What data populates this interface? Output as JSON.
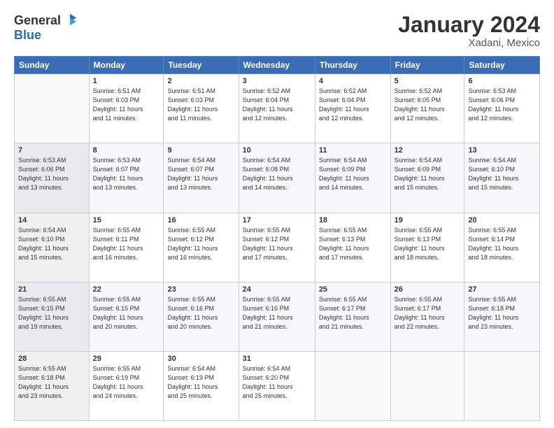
{
  "logo": {
    "general": "General",
    "blue": "Blue"
  },
  "title": "January 2024",
  "location": "Xadani, Mexico",
  "header_days": [
    "Sunday",
    "Monday",
    "Tuesday",
    "Wednesday",
    "Thursday",
    "Friday",
    "Saturday"
  ],
  "weeks": [
    [
      {
        "day": "",
        "info": ""
      },
      {
        "day": "1",
        "info": "Sunrise: 6:51 AM\nSunset: 6:03 PM\nDaylight: 11 hours\nand 11 minutes."
      },
      {
        "day": "2",
        "info": "Sunrise: 6:51 AM\nSunset: 6:03 PM\nDaylight: 11 hours\nand 11 minutes."
      },
      {
        "day": "3",
        "info": "Sunrise: 6:52 AM\nSunset: 6:04 PM\nDaylight: 11 hours\nand 12 minutes."
      },
      {
        "day": "4",
        "info": "Sunrise: 6:52 AM\nSunset: 6:04 PM\nDaylight: 11 hours\nand 12 minutes."
      },
      {
        "day": "5",
        "info": "Sunrise: 6:52 AM\nSunset: 6:05 PM\nDaylight: 11 hours\nand 12 minutes."
      },
      {
        "day": "6",
        "info": "Sunrise: 6:53 AM\nSunset: 6:06 PM\nDaylight: 11 hours\nand 12 minutes."
      }
    ],
    [
      {
        "day": "7",
        "info": "Sunrise: 6:53 AM\nSunset: 6:06 PM\nDaylight: 11 hours\nand 13 minutes."
      },
      {
        "day": "8",
        "info": "Sunrise: 6:53 AM\nSunset: 6:07 PM\nDaylight: 11 hours\nand 13 minutes."
      },
      {
        "day": "9",
        "info": "Sunrise: 6:54 AM\nSunset: 6:07 PM\nDaylight: 11 hours\nand 13 minutes."
      },
      {
        "day": "10",
        "info": "Sunrise: 6:54 AM\nSunset: 6:08 PM\nDaylight: 11 hours\nand 14 minutes."
      },
      {
        "day": "11",
        "info": "Sunrise: 6:54 AM\nSunset: 6:09 PM\nDaylight: 11 hours\nand 14 minutes."
      },
      {
        "day": "12",
        "info": "Sunrise: 6:54 AM\nSunset: 6:09 PM\nDaylight: 11 hours\nand 15 minutes."
      },
      {
        "day": "13",
        "info": "Sunrise: 6:54 AM\nSunset: 6:10 PM\nDaylight: 11 hours\nand 15 minutes."
      }
    ],
    [
      {
        "day": "14",
        "info": "Sunrise: 6:54 AM\nSunset: 6:10 PM\nDaylight: 11 hours\nand 15 minutes."
      },
      {
        "day": "15",
        "info": "Sunrise: 6:55 AM\nSunset: 6:11 PM\nDaylight: 11 hours\nand 16 minutes."
      },
      {
        "day": "16",
        "info": "Sunrise: 6:55 AM\nSunset: 6:12 PM\nDaylight: 11 hours\nand 16 minutes."
      },
      {
        "day": "17",
        "info": "Sunrise: 6:55 AM\nSunset: 6:12 PM\nDaylight: 11 hours\nand 17 minutes."
      },
      {
        "day": "18",
        "info": "Sunrise: 6:55 AM\nSunset: 6:13 PM\nDaylight: 11 hours\nand 17 minutes."
      },
      {
        "day": "19",
        "info": "Sunrise: 6:55 AM\nSunset: 6:13 PM\nDaylight: 11 hours\nand 18 minutes."
      },
      {
        "day": "20",
        "info": "Sunrise: 6:55 AM\nSunset: 6:14 PM\nDaylight: 11 hours\nand 18 minutes."
      }
    ],
    [
      {
        "day": "21",
        "info": "Sunrise: 6:55 AM\nSunset: 6:15 PM\nDaylight: 11 hours\nand 19 minutes."
      },
      {
        "day": "22",
        "info": "Sunrise: 6:55 AM\nSunset: 6:15 PM\nDaylight: 11 hours\nand 20 minutes."
      },
      {
        "day": "23",
        "info": "Sunrise: 6:55 AM\nSunset: 6:16 PM\nDaylight: 11 hours\nand 20 minutes."
      },
      {
        "day": "24",
        "info": "Sunrise: 6:55 AM\nSunset: 6:16 PM\nDaylight: 11 hours\nand 21 minutes."
      },
      {
        "day": "25",
        "info": "Sunrise: 6:55 AM\nSunset: 6:17 PM\nDaylight: 11 hours\nand 21 minutes."
      },
      {
        "day": "26",
        "info": "Sunrise: 6:55 AM\nSunset: 6:17 PM\nDaylight: 11 hours\nand 22 minutes."
      },
      {
        "day": "27",
        "info": "Sunrise: 6:55 AM\nSunset: 6:18 PM\nDaylight: 11 hours\nand 23 minutes."
      }
    ],
    [
      {
        "day": "28",
        "info": "Sunrise: 6:55 AM\nSunset: 6:18 PM\nDaylight: 11 hours\nand 23 minutes."
      },
      {
        "day": "29",
        "info": "Sunrise: 6:55 AM\nSunset: 6:19 PM\nDaylight: 11 hours\nand 24 minutes."
      },
      {
        "day": "30",
        "info": "Sunrise: 6:54 AM\nSunset: 6:19 PM\nDaylight: 11 hours\nand 25 minutes."
      },
      {
        "day": "31",
        "info": "Sunrise: 6:54 AM\nSunset: 6:20 PM\nDaylight: 11 hours\nand 25 minutes."
      },
      {
        "day": "",
        "info": ""
      },
      {
        "day": "",
        "info": ""
      },
      {
        "day": "",
        "info": ""
      }
    ]
  ]
}
